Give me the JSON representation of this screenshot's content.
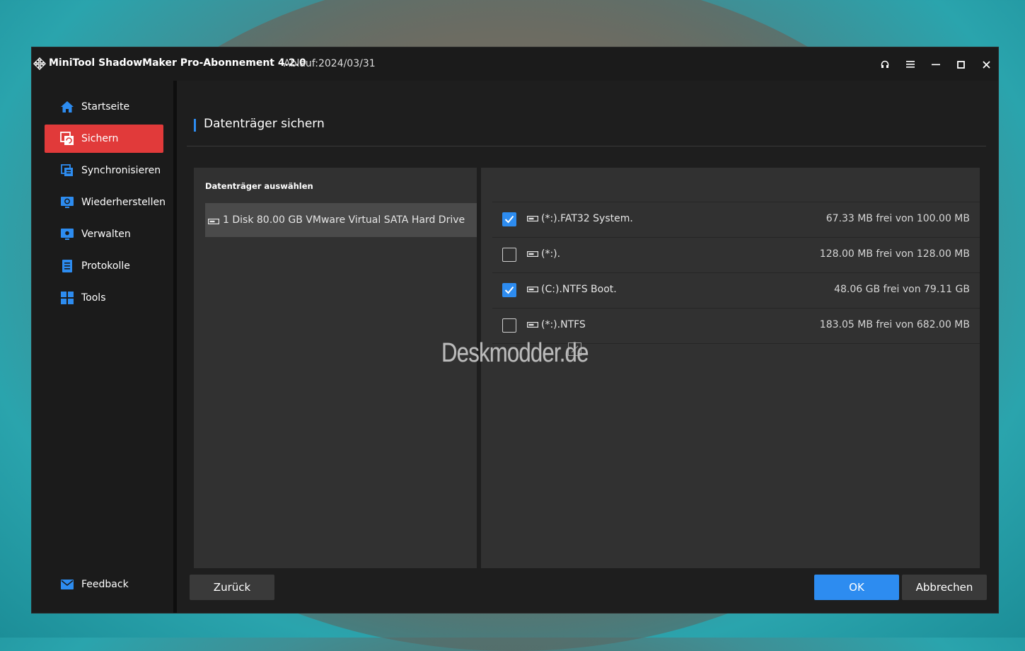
{
  "window": {
    "title": "MiniTool ShadowMaker Pro-Abonnement 4.2.0",
    "expiry": "Ablauf:2024/03/31"
  },
  "sidebar": {
    "items": [
      {
        "label": "Startseite",
        "icon": "home-icon",
        "active": false
      },
      {
        "label": "Sichern",
        "icon": "backup-icon",
        "active": true
      },
      {
        "label": "Synchronisieren",
        "icon": "sync-icon",
        "active": false
      },
      {
        "label": "Wiederherstellen",
        "icon": "restore-icon",
        "active": false
      },
      {
        "label": "Verwalten",
        "icon": "manage-icon",
        "active": false
      },
      {
        "label": "Protokolle",
        "icon": "logs-icon",
        "active": false
      },
      {
        "label": "Tools",
        "icon": "tools-icon",
        "active": false
      }
    ],
    "feedback": {
      "label": "Feedback",
      "icon": "mail-icon"
    }
  },
  "main": {
    "title": "Datenträger sichern",
    "left_panel": {
      "header": "Datenträger auswählen",
      "disks": [
        {
          "label": "1 Disk 80.00 GB VMware Virtual SATA Hard Drive",
          "selected": true
        }
      ]
    },
    "partitions": [
      {
        "name": "(*:).FAT32 System.",
        "size": "67.33 MB frei von 100.00 MB",
        "checked": true
      },
      {
        "name": "(*:).",
        "size": "128.00 MB frei von 128.00 MB",
        "checked": false
      },
      {
        "name": "(C:).NTFS Boot.",
        "size": "48.06 GB frei von 79.11 GB",
        "checked": true
      },
      {
        "name": "(*:).NTFS",
        "size": "183.05 MB frei von 682.00 MB",
        "checked": false
      }
    ]
  },
  "buttons": {
    "back": "Zurück",
    "ok": "OK",
    "cancel": "Abbrechen"
  },
  "watermark": "Deskmodder.de",
  "colors": {
    "accent": "#2d8cf0",
    "active_nav": "#e13a3a",
    "icon_blue": "#2d8cf0"
  }
}
